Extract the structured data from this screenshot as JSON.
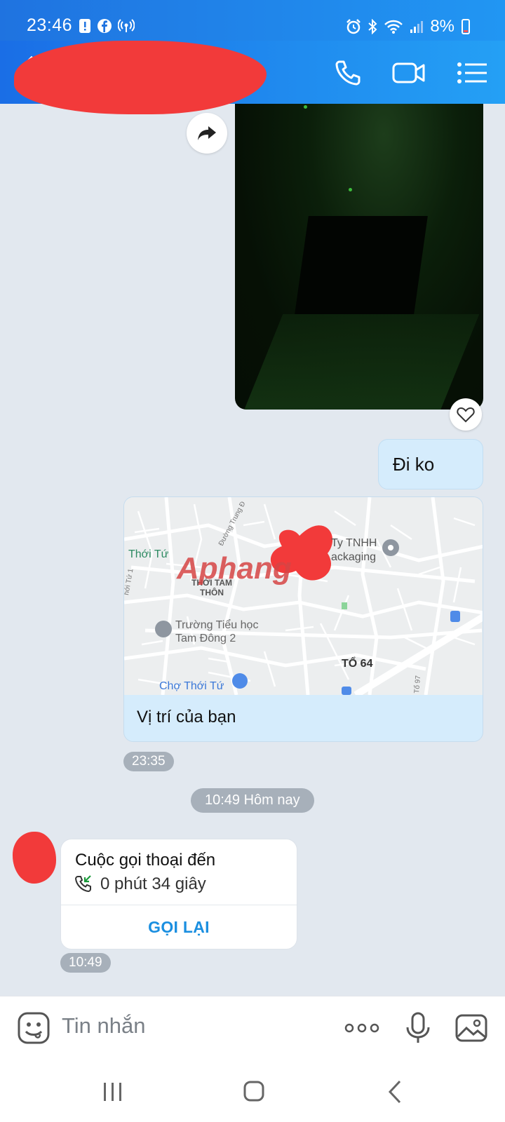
{
  "status_bar": {
    "time": "23:46",
    "battery": "8%"
  },
  "header": {
    "contact_name": ""
  },
  "messages": {
    "outgoing_text": "Đi ko",
    "location": {
      "title": "Vị trí của bạn",
      "time": "23:35",
      "map_labels": {
        "thoi_tu": "Thới Tứ",
        "thoi_tam_thon_1": "THỚI TAM",
        "thoi_tam_thon_2": "THÔN",
        "school_1": "Trường Tiểu học",
        "school_2": "Tam Đông 2",
        "market": "Chợ Thới Tứ",
        "to64": "TỔ 64",
        "company_1": "Ty TNHH",
        "company_2": "ackaging",
        "road_1": "Đường Trung Đ",
        "road_2": "hới Tứ 1",
        "road_3": "Tổ 97",
        "watermark": "Aphang"
      }
    },
    "date_divider": "10:49 Hôm nay",
    "call": {
      "title": "Cuộc gọi thoại đến",
      "duration": "0 phút 34 giây",
      "callback": "GỌI LẠI",
      "time": "10:49"
    }
  },
  "composer": {
    "placeholder": "Tin nhắn"
  },
  "icons": {
    "header": [
      "back-icon",
      "phone-icon",
      "video-icon",
      "menu-icon"
    ],
    "composer": [
      "sticker-icon",
      "more-icon",
      "mic-icon",
      "image-icon"
    ],
    "nav": [
      "recents-icon",
      "home-icon",
      "back-nav-icon"
    ]
  },
  "colors": {
    "header": "#1a6ee6",
    "bubble_out": "#d5ecfc",
    "accent": "#1b8fe0",
    "redaction": "#f23a3a"
  }
}
